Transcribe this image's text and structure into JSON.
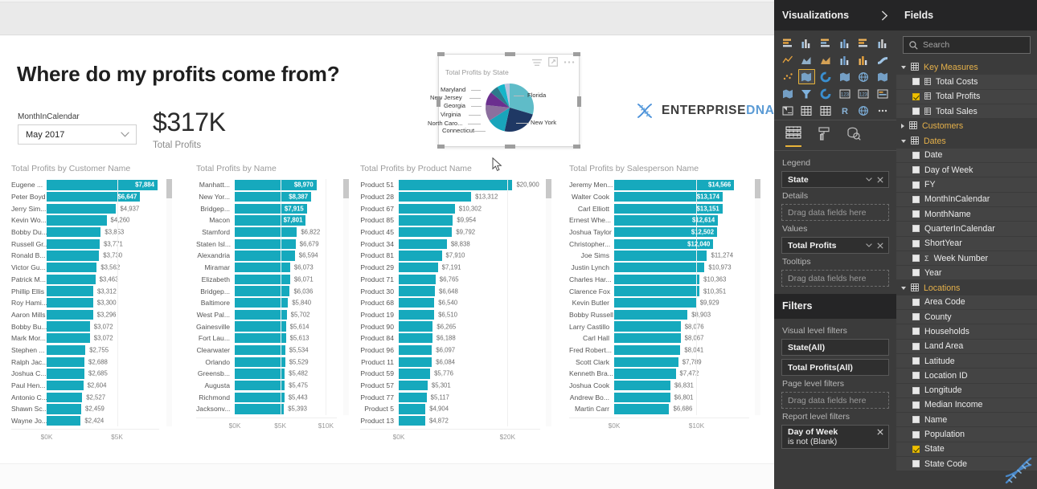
{
  "report": {
    "title": "Where do my profits come from?",
    "logo": {
      "part1": "ENTERPRISE",
      "part2": "DNA",
      "icon": "dna-helix-icon"
    },
    "slicer": {
      "label": "MonthInCalendar",
      "value": "May 2017",
      "icon": "chevron-down-icon"
    },
    "kpi": {
      "value": "$317K",
      "label": "Total Profits"
    }
  },
  "chart_data": [
    {
      "type": "bar",
      "title": "Total Profits by Customer Name",
      "xlabel": "",
      "ylabel": "",
      "orientation": "horizontal",
      "xlim": [
        0,
        8000
      ],
      "ticks": [
        "$0K",
        "$5K"
      ],
      "tick_values": [
        0,
        5000
      ],
      "grid": true,
      "categories": [
        "Eugene ...",
        "Peter Boyd",
        "Jerry Sim...",
        "Kevin Wo...",
        "Bobby Du...",
        "Russell Gr...",
        "Ronald B...",
        "Victor Gu...",
        "Patrick M...",
        "Phillip Ellis",
        "Roy Hami...",
        "Aaron Mills",
        "Bobby Bu...",
        "Mark Mor...",
        "Stephen ...",
        "Ralph Jac...",
        "Joshua C...",
        "Paul Hen...",
        "Antonio C...",
        "Shawn Sc...",
        "Wayne Jo..."
      ],
      "values": [
        7884,
        6647,
        4937,
        4260,
        3853,
        3771,
        3730,
        3562,
        3463,
        3312,
        3300,
        3296,
        3072,
        3072,
        2755,
        2688,
        2685,
        2604,
        2527,
        2459,
        2424
      ],
      "labels": [
        "$7,884",
        "$6,647",
        "$4,937",
        "$4,260",
        "$3,853",
        "$3,771",
        "$3,730",
        "$3,562",
        "$3,463",
        "$3,312",
        "$3,300",
        "$3,296",
        "$3,072",
        "$3,072",
        "$2,755",
        "$2,688",
        "$2,685",
        "$2,604",
        "$2,527",
        "$2,459",
        "$2,424"
      ],
      "label_inside": [
        true,
        true,
        false,
        false,
        false,
        false,
        false,
        false,
        false,
        false,
        false,
        false,
        false,
        false,
        false,
        false,
        false,
        false,
        false,
        false,
        false
      ]
    },
    {
      "type": "bar",
      "title": "Total Profits by Name",
      "xlabel": "",
      "ylabel": "",
      "orientation": "horizontal",
      "xlim": [
        0,
        11200
      ],
      "ticks": [
        "$0K",
        "$5K",
        "$10K"
      ],
      "tick_values": [
        0,
        5000,
        10000
      ],
      "grid": true,
      "categories": [
        "Manhatt...",
        "New Yor...",
        "Bridgep...",
        "Macon",
        "Stamford",
        "Staten Isl...",
        "Alexandria",
        "Miramar",
        "Elizabeth",
        "Bridgep...",
        "Baltimore",
        "West Pal...",
        "Gainesville",
        "Fort Lau...",
        "Clearwater",
        "Orlando",
        "Greensb...",
        "Augusta",
        "Richmond",
        "Jacksonv..."
      ],
      "values": [
        8970,
        8387,
        7915,
        7801,
        6822,
        6679,
        6594,
        6073,
        6071,
        6036,
        5840,
        5702,
        5614,
        5613,
        5534,
        5529,
        5482,
        5475,
        5443,
        5393
      ],
      "labels": [
        "$8,970",
        "$8,387",
        "$7,915",
        "$7,801",
        "$6,822",
        "$6,679",
        "$6,594",
        "$6,073",
        "$6,071",
        "$6,036",
        "$5,840",
        "$5,702",
        "$5,614",
        "$5,613",
        "$5,534",
        "$5,529",
        "$5,482",
        "$5,475",
        "$5,443",
        "$5,393"
      ],
      "label_inside": [
        true,
        true,
        true,
        true,
        false,
        false,
        false,
        false,
        false,
        false,
        false,
        false,
        false,
        false,
        false,
        false,
        false,
        false,
        false,
        false
      ]
    },
    {
      "type": "bar",
      "title": "Total Profits by Product Name",
      "xlabel": "",
      "ylabel": "",
      "orientation": "horizontal",
      "xlim": [
        0,
        26000
      ],
      "ticks": [
        "$0K",
        "$20K"
      ],
      "tick_values": [
        0,
        20000
      ],
      "grid": true,
      "categories": [
        "Product 51",
        "Product 28",
        "Product 67",
        "Product 85",
        "Product 45",
        "Product 34",
        "Product 81",
        "Product 29",
        "Product 71",
        "Product 30",
        "Product 68",
        "Product 19",
        "Product 90",
        "Product 84",
        "Product 96",
        "Product 11",
        "Product 59",
        "Product 57",
        "Product 77",
        "Product 5",
        "Product 13"
      ],
      "values": [
        20900,
        13312,
        10302,
        9954,
        9792,
        8838,
        7910,
        7191,
        6765,
        6648,
        6540,
        6510,
        6265,
        6188,
        6097,
        6084,
        5776,
        5301,
        5117,
        4904,
        4872
      ],
      "labels": [
        "$20,900",
        "$13,312",
        "$10,302",
        "$9,954",
        "$9,792",
        "$8,838",
        "$7,910",
        "$7,191",
        "$6,765",
        "$6,648",
        "$6,540",
        "$6,510",
        "$6,265",
        "$6,188",
        "$6,097",
        "$6,084",
        "$5,776",
        "$5,301",
        "$5,117",
        "$4,904",
        "$4,872"
      ],
      "label_inside": [
        false,
        false,
        false,
        false,
        false,
        false,
        false,
        false,
        false,
        false,
        false,
        false,
        false,
        false,
        false,
        false,
        false,
        false,
        false,
        false,
        false
      ]
    },
    {
      "type": "bar",
      "title": "Total Profits by Salesperson Name",
      "xlabel": "",
      "ylabel": "",
      "orientation": "horizontal",
      "xlim": [
        0,
        16400
      ],
      "ticks": [
        "$0K",
        "$10K"
      ],
      "tick_values": [
        0,
        10000
      ],
      "grid": true,
      "categories": [
        "Jeremy Men...",
        "Walter Cook",
        "Carl Elliott",
        "Ernest Whe...",
        "Joshua Taylor",
        "Christopher...",
        "Joe Sims",
        "Justin Lynch",
        "Charles Har...",
        "Clarence Fox",
        "Kevin Butler",
        "Bobby Russell",
        "Larry Castillo",
        "Carl Hall",
        "Fred Robert...",
        "Scott Clark",
        "Kenneth Bra...",
        "Joshua Cook",
        "Andrew Bo...",
        "Martin Carr"
      ],
      "values": [
        14566,
        13174,
        13151,
        12614,
        12502,
        12040,
        11274,
        10973,
        10363,
        10351,
        9929,
        8903,
        8076,
        8067,
        8041,
        7789,
        7472,
        6831,
        6801,
        6686
      ],
      "labels": [
        "$14,566",
        "$13,174",
        "$13,151",
        "$12,614",
        "$12,502",
        "$12,040",
        "$11,274",
        "$10,973",
        "$10,363",
        "$10,351",
        "$9,929",
        "$8,903",
        "$8,076",
        "$8,067",
        "$8,041",
        "$7,789",
        "$7,472",
        "$6,831",
        "$6,801",
        "$6,686"
      ],
      "label_inside": [
        true,
        true,
        true,
        true,
        true,
        true,
        false,
        false,
        false,
        false,
        false,
        false,
        false,
        false,
        false,
        false,
        false,
        false,
        false,
        false
      ]
    },
    {
      "type": "pie",
      "title": "Total Profits by State",
      "labels": [
        "Florida",
        "New York",
        "Connecticut",
        "North Caro...",
        "Virginia",
        "Georgia",
        "New Jersey",
        "Maryland"
      ],
      "values": [
        26,
        21,
        11,
        9.5,
        8,
        5,
        4.5,
        3
      ],
      "colors": [
        "#5fbcc8",
        "#1f3864",
        "#19a5bb",
        "#8c6f9e",
        "#6b2f8f",
        "#2d7a8c",
        "#16b5c9",
        "#b7c3dd"
      ],
      "legend_position": "labels-outside"
    }
  ],
  "visualizations": {
    "header": "Visualizations",
    "expand_icon": "chevron-right-icon",
    "icons": [
      "stacked-bar-chart-icon",
      "stacked-column-chart-icon",
      "clustered-bar-chart-icon",
      "clustered-column-chart-icon",
      "100-stacked-bar-chart-icon",
      "100-stacked-column-chart-icon",
      "line-chart-icon",
      "area-chart-icon",
      "stacked-area-chart-icon",
      "line-stacked-column-chart-icon",
      "line-clustered-column-chart-icon",
      "ribbon-chart-icon",
      "scatter-chart-icon",
      "map-icon",
      "donut-chart-icon",
      "treemap-icon",
      "globe-map-icon",
      "filled-map-icon",
      "shape-map-icon",
      "funnel-chart-icon",
      "gauge-chart-icon",
      "card-icon",
      "multi-row-card-icon",
      "kpi-icon",
      "slicer-icon",
      "table-icon",
      "matrix-icon",
      "r-script-visual-icon",
      "python-visual-icon",
      "more-options-icon"
    ],
    "selected_icon_index": 13,
    "tabs": [
      "fields-pane-tab",
      "format-paintbrush-tab",
      "analytics-magnifier-tab"
    ],
    "active_tab": 0,
    "wells": [
      {
        "label": "Legend",
        "type": "chip",
        "value": "State",
        "icons": [
          "chevron-down-icon",
          "close-icon"
        ]
      },
      {
        "label": "Details",
        "type": "drop",
        "value": "Drag data fields here"
      },
      {
        "label": "Values",
        "type": "chip",
        "value": "Total Profits",
        "icons": [
          "chevron-down-icon",
          "close-icon"
        ]
      },
      {
        "label": "Tooltips",
        "type": "drop",
        "value": "Drag data fields here"
      }
    ]
  },
  "filters": {
    "header": "Filters",
    "groups": [
      {
        "label": "Visual level filters",
        "items": [
          {
            "text": "State(All)",
            "type": "chip"
          },
          {
            "text": "Total Profits(All)",
            "type": "chip"
          }
        ]
      },
      {
        "label": "Page level filters",
        "items": [
          {
            "text": "Drag data fields here",
            "type": "drop"
          }
        ]
      },
      {
        "label": "Report level filters",
        "items": [
          {
            "text": "Day of Week",
            "sub": "is not (Blank)",
            "type": "chip",
            "icon": "close-icon"
          }
        ]
      }
    ]
  },
  "fields": {
    "header": "Fields",
    "search": {
      "placeholder": "Search",
      "icon": "search-icon"
    },
    "tables": [
      {
        "name": "Key Measures",
        "expanded": true,
        "icon": "measure-table-icon",
        "fields": [
          {
            "name": "Total Costs",
            "checked": false,
            "icon": "measure-icon"
          },
          {
            "name": "Total Profits",
            "checked": true,
            "icon": "measure-icon"
          },
          {
            "name": "Total Sales",
            "checked": false,
            "icon": "measure-icon"
          }
        ]
      },
      {
        "name": "Customers",
        "expanded": false,
        "icon": "table-icon",
        "fields": []
      },
      {
        "name": "Dates",
        "expanded": true,
        "icon": "table-icon",
        "fields": [
          {
            "name": "Date",
            "checked": false
          },
          {
            "name": "Day of Week",
            "checked": false
          },
          {
            "name": "FY",
            "checked": false
          },
          {
            "name": "MonthInCalendar",
            "checked": false
          },
          {
            "name": "MonthName",
            "checked": false
          },
          {
            "name": "QuarterInCalendar",
            "checked": false
          },
          {
            "name": "ShortYear",
            "checked": false
          },
          {
            "name": "Week Number",
            "checked": false,
            "aggregate": "Σ"
          },
          {
            "name": "Year",
            "checked": false
          }
        ]
      },
      {
        "name": "Locations",
        "expanded": true,
        "icon": "table-icon",
        "fields": [
          {
            "name": "Area Code",
            "checked": false
          },
          {
            "name": "County",
            "checked": false
          },
          {
            "name": "Households",
            "checked": false
          },
          {
            "name": "Land Area",
            "checked": false
          },
          {
            "name": "Latitude",
            "checked": false
          },
          {
            "name": "Location ID",
            "checked": false
          },
          {
            "name": "Longitude",
            "checked": false
          },
          {
            "name": "Median Income",
            "checked": false
          },
          {
            "name": "Name",
            "checked": false
          },
          {
            "name": "Population",
            "checked": false
          },
          {
            "name": "State",
            "checked": true
          },
          {
            "name": "State Code",
            "checked": false
          }
        ]
      }
    ]
  },
  "colors": {
    "bar": "#16a9bd",
    "accent_yellow": "#e8b339",
    "pane_bg": "#3b3b3b",
    "pane_header_bg": "#252526"
  }
}
